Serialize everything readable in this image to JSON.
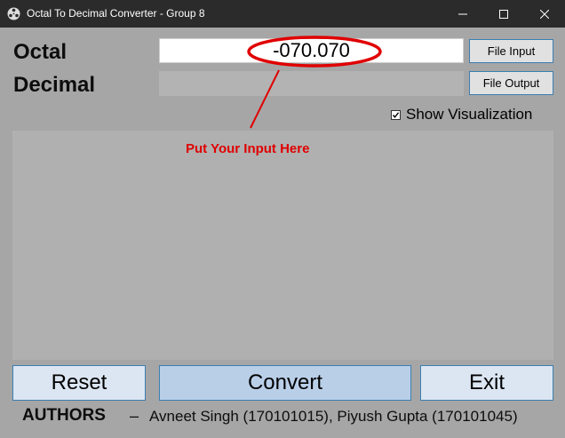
{
  "window": {
    "title": "Octal To Decimal Converter - Group 8"
  },
  "form": {
    "octal_label": "Octal",
    "decimal_label": "Decimal",
    "octal_value": "-070.070",
    "decimal_value": "",
    "file_input_label": "File Input",
    "file_output_label": "File Output",
    "show_visualization_label": "Show Visualization",
    "show_visualization_checked": true
  },
  "annotation": {
    "text": "Put Your Input Here",
    "color": "#e00000"
  },
  "buttons": {
    "reset": "Reset",
    "convert": "Convert",
    "exit": "Exit"
  },
  "footer": {
    "authors_label": "AUTHORS",
    "dash": "–",
    "authors_names": "Avneet Singh (170101015), Piyush Gupta (170101045)"
  },
  "icons": {
    "app": "film-reel-icon",
    "minimize": "minimize-icon",
    "maximize": "maximize-icon",
    "close": "close-icon",
    "check": "check-icon"
  },
  "colors": {
    "titlebar": "#2b2b2b",
    "background": "#a6a6a6",
    "convert_button": "#b9cfe8",
    "button_border": "#3c7fb1"
  }
}
